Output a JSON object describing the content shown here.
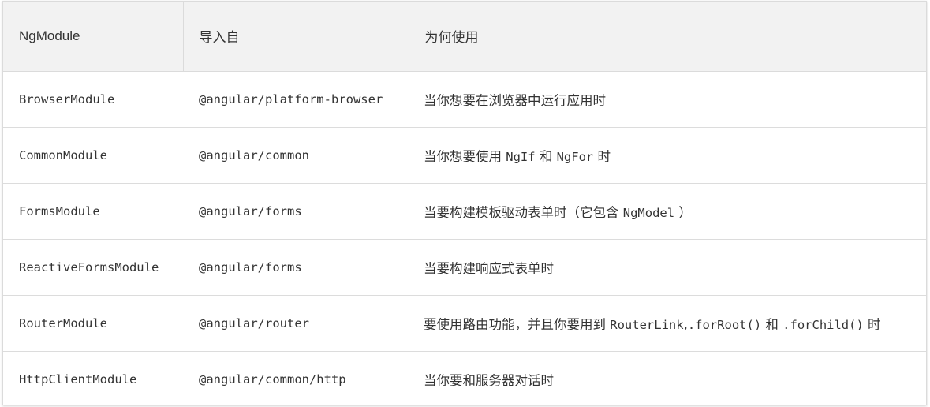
{
  "table": {
    "headers": [
      "NgModule",
      "导入自",
      "为何使用"
    ],
    "rows": [
      {
        "module": "BrowserModule",
        "import": "@angular/platform-browser",
        "why": [
          {
            "t": "当你想要在浏览器中运行应用时"
          }
        ]
      },
      {
        "module": "CommonModule",
        "import": "@angular/common",
        "why": [
          {
            "t": "当你想要使用 "
          },
          {
            "c": "NgIf"
          },
          {
            "t": " 和 "
          },
          {
            "c": "NgFor"
          },
          {
            "t": " 时"
          }
        ]
      },
      {
        "module": "FormsModule",
        "import": "@angular/forms",
        "why": [
          {
            "t": "当要构建模板驱动表单时（它包含 "
          },
          {
            "c": "NgModel"
          },
          {
            "t": " ）"
          }
        ]
      },
      {
        "module": "ReactiveFormsModule",
        "import": "@angular/forms",
        "why": [
          {
            "t": "当要构建响应式表单时"
          }
        ]
      },
      {
        "module": "RouterModule",
        "import": "@angular/router",
        "why": [
          {
            "t": "要使用路由功能，并且你要用到 "
          },
          {
            "c": "RouterLink"
          },
          {
            "t": ","
          },
          {
            "c": ".forRoot()"
          },
          {
            "t": " 和 "
          },
          {
            "c": ".forChild()"
          },
          {
            "t": " 时"
          }
        ]
      },
      {
        "module": "HttpClientModule",
        "import": "@angular/common/http",
        "why": [
          {
            "t": "当你要和服务器对话时"
          }
        ]
      }
    ]
  }
}
